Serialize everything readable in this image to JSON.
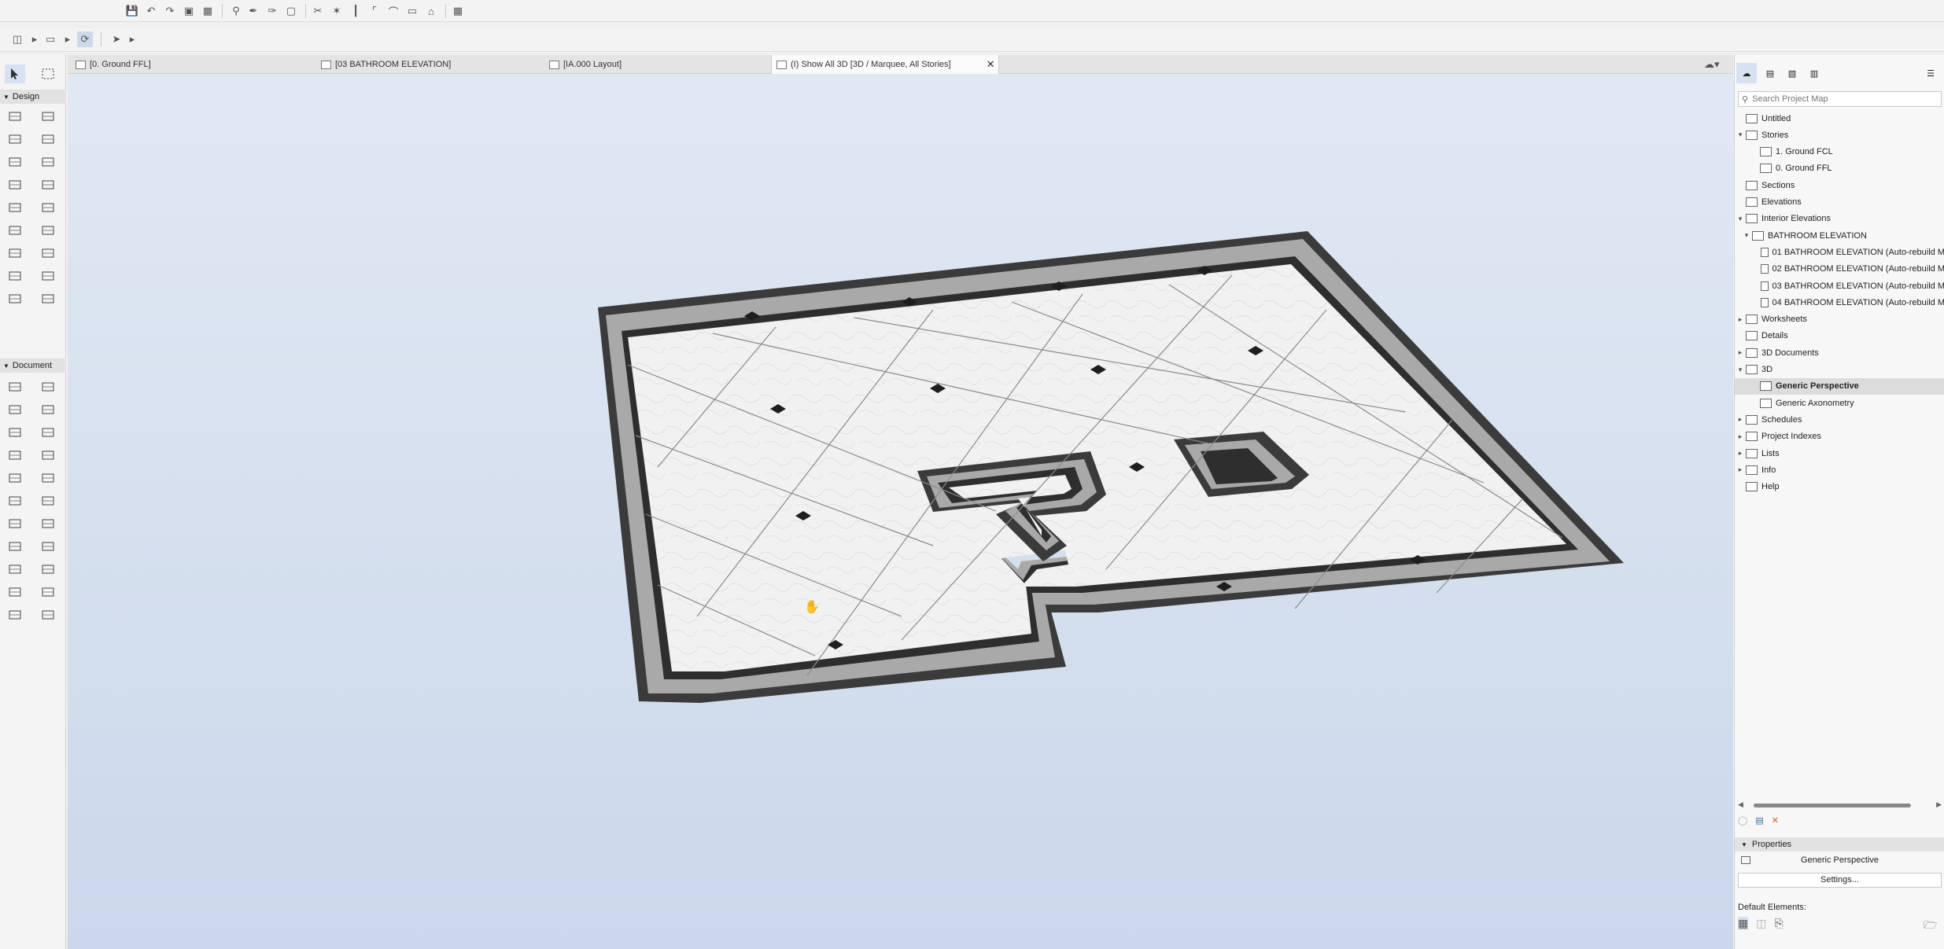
{
  "tabs": [
    {
      "label": "[0. Ground FFL]"
    },
    {
      "label": "[03 BATHROOM ELEVATION]"
    },
    {
      "label": "[IA.000 Layout]"
    },
    {
      "label": "(I) Show All 3D [3D / Marquee, All Stories]"
    }
  ],
  "toolbox": {
    "design_label": "Design",
    "document_label": "Document"
  },
  "navigator": {
    "search_placeholder": "Search Project Map",
    "items": [
      {
        "label": "Untitled"
      },
      {
        "label": "Stories"
      },
      {
        "label": "1. Ground FCL"
      },
      {
        "label": "0. Ground FFL"
      },
      {
        "label": "Sections"
      },
      {
        "label": "Elevations"
      },
      {
        "label": "Interior Elevations"
      },
      {
        "label": "BATHROOM ELEVATION"
      },
      {
        "label": "01 BATHROOM ELEVATION (Auto-rebuild M"
      },
      {
        "label": "02 BATHROOM ELEVATION (Auto-rebuild M"
      },
      {
        "label": "03 BATHROOM ELEVATION (Auto-rebuild M"
      },
      {
        "label": "04 BATHROOM ELEVATION (Auto-rebuild M"
      },
      {
        "label": "Worksheets"
      },
      {
        "label": "Details"
      },
      {
        "label": "3D Documents"
      },
      {
        "label": "3D"
      },
      {
        "label": "Generic Perspective"
      },
      {
        "label": "Generic Axonometry"
      },
      {
        "label": "Schedules"
      },
      {
        "label": "Project Indexes"
      },
      {
        "label": "Lists"
      },
      {
        "label": "Info"
      },
      {
        "label": "Help"
      }
    ]
  },
  "properties": {
    "header": "Properties",
    "name": "Generic Perspective",
    "settings_label": "Settings...",
    "default_elements_label": "Default Elements:"
  }
}
